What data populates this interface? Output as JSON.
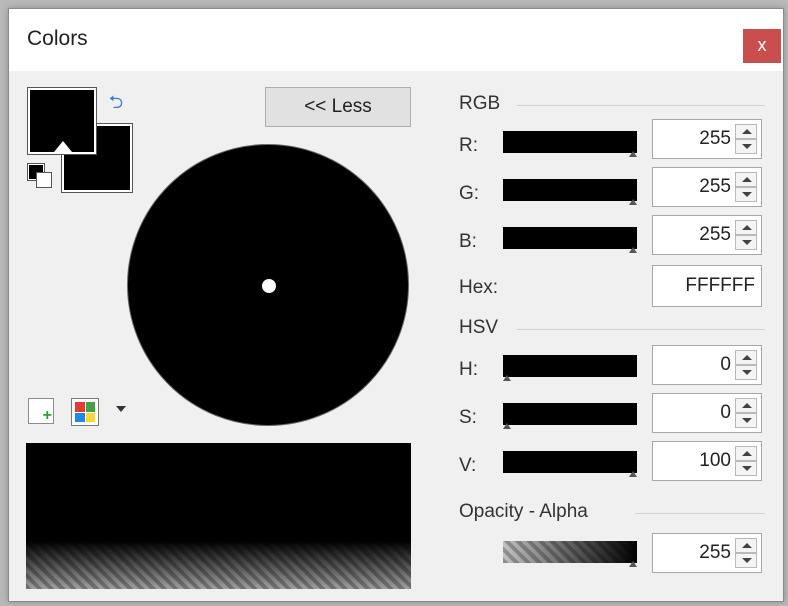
{
  "window": {
    "title": "Colors",
    "close_label": "x"
  },
  "swatches": {
    "primary": "#000000",
    "secondary": "#000000"
  },
  "icons": {
    "swap": "swap-colors-icon",
    "reset": "reset-colors-icon",
    "add_palette": "add-to-palette-icon",
    "palette": "palette-icon",
    "dropdown": "chevron-down-icon"
  },
  "toggle": {
    "label": "<< Less"
  },
  "rgb": {
    "label": "RGB",
    "rows": [
      {
        "label": "R:",
        "value": "255",
        "level": 1.0
      },
      {
        "label": "G:",
        "value": "255",
        "level": 1.0
      },
      {
        "label": "B:",
        "value": "255",
        "level": 1.0
      }
    ]
  },
  "hex": {
    "label": "Hex:",
    "value": "FFFFFF"
  },
  "hsv": {
    "label": "HSV",
    "rows": [
      {
        "label": "H:",
        "value": "0",
        "level": 0.0
      },
      {
        "label": "S:",
        "value": "0",
        "level": 0.0
      },
      {
        "label": "V:",
        "value": "100",
        "level": 1.0
      }
    ]
  },
  "alpha": {
    "label": "Opacity - Alpha",
    "value": "255",
    "level": 1.0
  },
  "colors": {
    "close_bg": "#c94f4f",
    "accent": "#3a7bd5"
  }
}
